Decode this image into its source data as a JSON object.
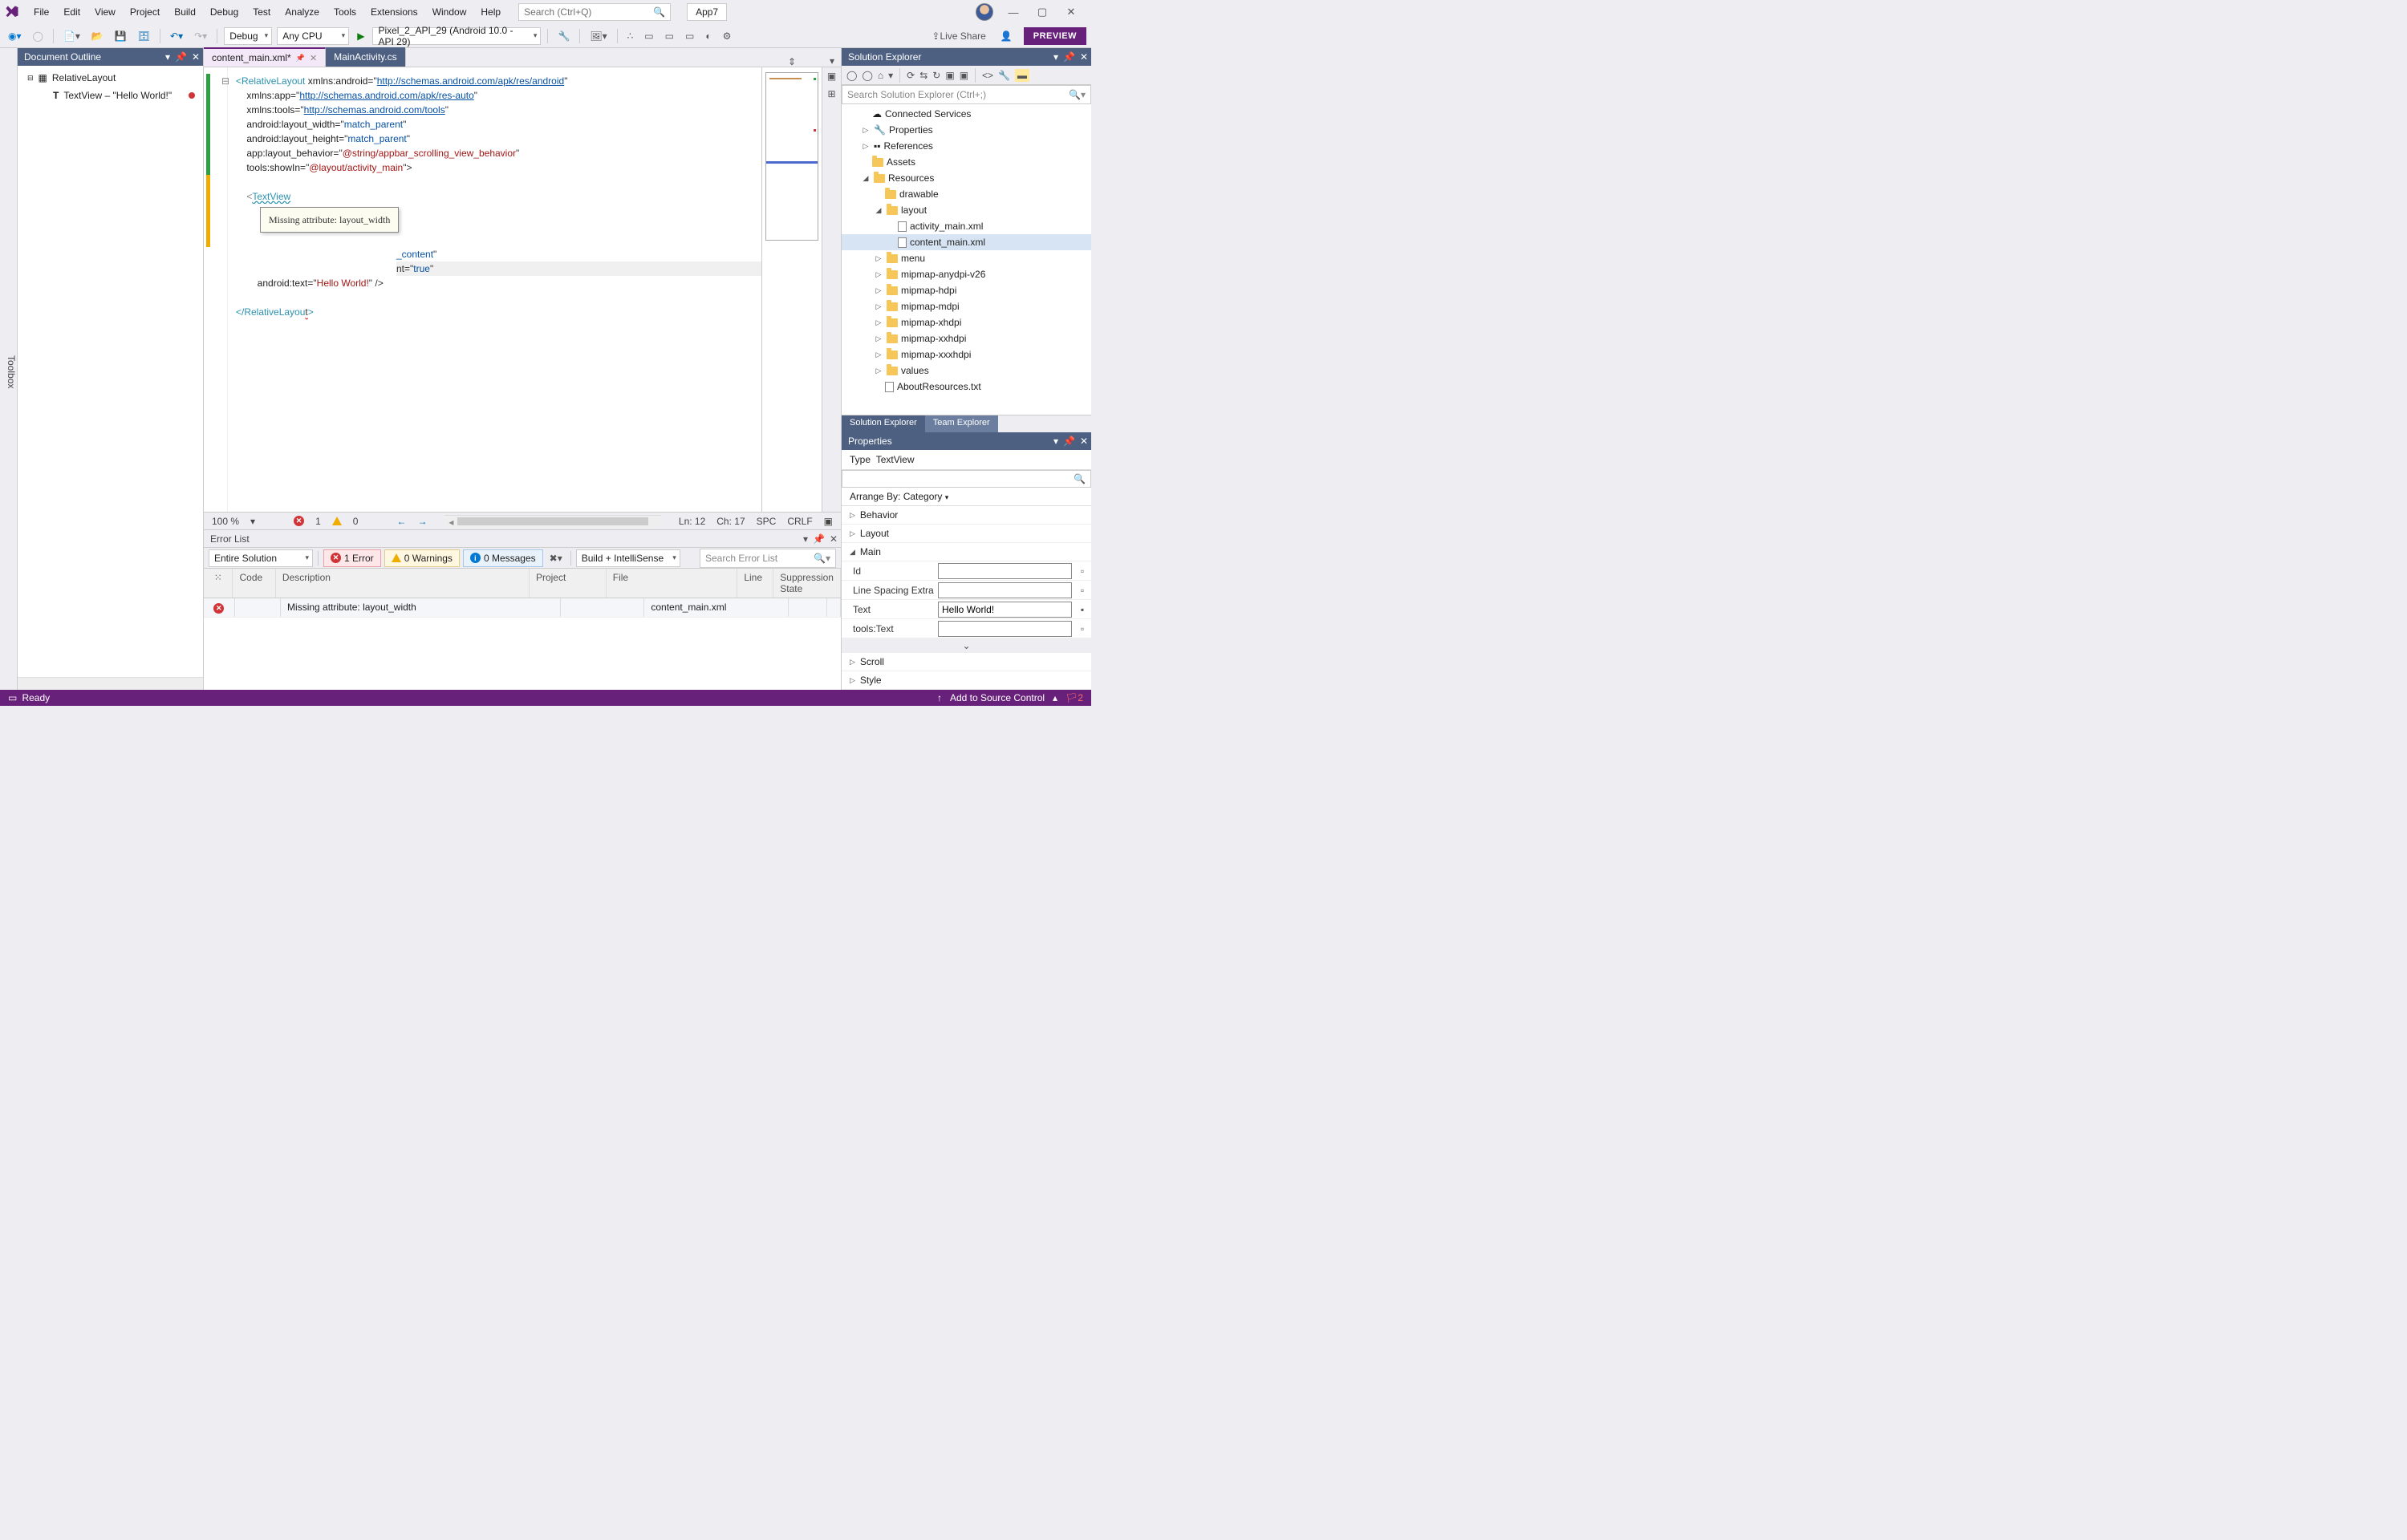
{
  "menu": {
    "items": [
      "File",
      "Edit",
      "View",
      "Project",
      "Build",
      "Debug",
      "Test",
      "Analyze",
      "Tools",
      "Extensions",
      "Window",
      "Help"
    ]
  },
  "search": {
    "placeholder": "Search (Ctrl+Q)"
  },
  "app_name": "App7",
  "toolbar": {
    "config": "Debug",
    "platform": "Any CPU",
    "target": "Pixel_2_API_29 (Android 10.0 - API 29)",
    "live_share": "Live Share",
    "preview": "PREVIEW"
  },
  "toolbox_label": "Toolbox",
  "doc_outline": {
    "title": "Document Outline",
    "root": "RelativeLayout",
    "child": "TextView  –  \"Hello World!\""
  },
  "tabs": {
    "active": "content_main.xml*",
    "other": "MainActivity.cs"
  },
  "code": {
    "l1": "<RelativeLayout xmlns:android=\"",
    "url1": "http://schemas.android.com/apk/res/android",
    "l2a": "    xmlns:app=\"",
    "url2": "http://schemas.android.com/apk/res-auto",
    "l3a": "    xmlns:tools=\"",
    "url3": "http://schemas.android.com/tools",
    "l4": "    android:layout_width=\"",
    "v4": "match_parent",
    "l5": "    android:layout_height=\"",
    "v5": "match_parent",
    "l6": "    app:layout_behavior=\"",
    "v6": "@string/appbar_scrolling_view_behavior",
    "l7": "    tools:showIn=\"",
    "v7": "@layout/activity_main",
    "l7end": "\">",
    "l9a": "    <",
    "l9b": "TextView",
    "l10b": "_content",
    "l11a": "nt=\"",
    "l11b": "true",
    "l12a": "        android:text=\"",
    "l12b": "Hello World!",
    "l12c": "\" />",
    "l14": "</RelativeLayout>"
  },
  "tooltip": "Missing attribute: layout_width",
  "editor_status": {
    "zoom": "100 %",
    "errors": "1",
    "warnings": "0",
    "ln": "Ln: 12",
    "ch": "Ch: 17",
    "spc": "SPC",
    "crlf": "CRLF"
  },
  "error_list": {
    "title": "Error List",
    "scope": "Entire Solution",
    "err_pill": "1 Error",
    "warn_pill": "0 Warnings",
    "msg_pill": "0 Messages",
    "build_pill": "Build + IntelliSense",
    "search_placeholder": "Search Error List",
    "cols": {
      "code": "Code",
      "desc": "Description",
      "proj": "Project",
      "file": "File",
      "line": "Line",
      "supp": "Suppression State"
    },
    "row": {
      "desc": "Missing attribute: layout_width",
      "file": "content_main.xml"
    }
  },
  "solution": {
    "title": "Solution Explorer",
    "search_placeholder": "Search Solution Explorer (Ctrl+;)",
    "nodes": {
      "connected": "Connected Services",
      "props": "Properties",
      "refs": "References",
      "assets": "Assets",
      "resources": "Resources",
      "drawable": "drawable",
      "layout": "layout",
      "activity": "activity_main.xml",
      "content": "content_main.xml",
      "menu": "menu",
      "mipany": "mipmap-anydpi-v26",
      "miph": "mipmap-hdpi",
      "mipm": "mipmap-mdpi",
      "mipxh": "mipmap-xhdpi",
      "mipxxh": "mipmap-xxhdpi",
      "mipxxxh": "mipmap-xxxhdpi",
      "values": "values",
      "about": "AboutResources.txt"
    },
    "tabs": {
      "sol": "Solution Explorer",
      "team": "Team Explorer"
    }
  },
  "properties": {
    "title": "Properties",
    "type_label": "Type",
    "type_value": "TextView",
    "arrange": "Arrange By: Category",
    "cats": {
      "behavior": "Behavior",
      "layout": "Layout",
      "main": "Main",
      "scroll": "Scroll",
      "style": "Style"
    },
    "fields": {
      "id": "Id",
      "lse": "Line Spacing Extra",
      "text": "Text",
      "toolstext": "tools:Text"
    },
    "text_value": "Hello World!"
  },
  "status": {
    "ready": "Ready",
    "source_ctrl": "Add to Source Control"
  }
}
